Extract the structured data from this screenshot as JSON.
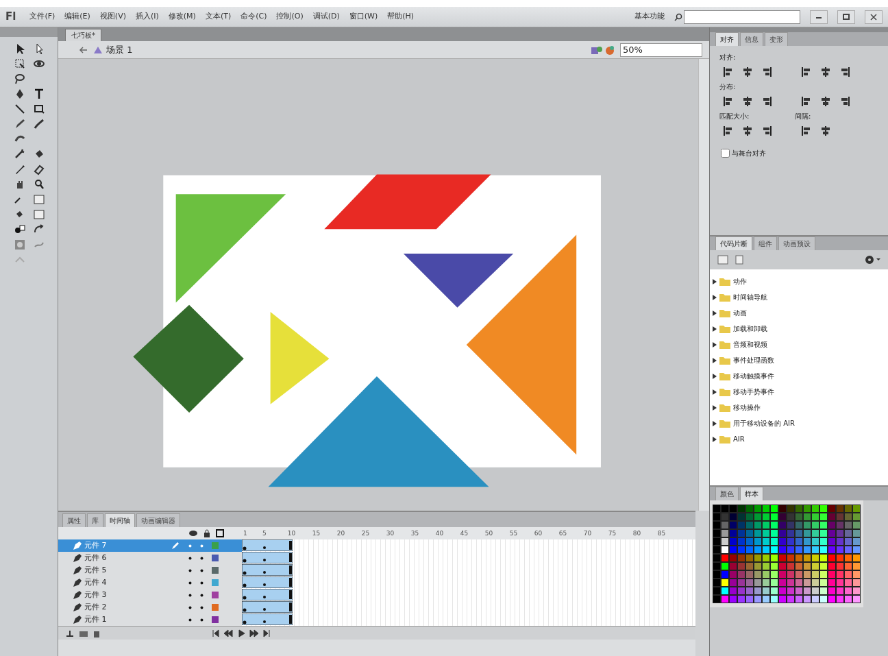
{
  "app": {
    "logo": "Fl",
    "workspace": "基本功能"
  },
  "menu": [
    "文件(F)",
    "编辑(E)",
    "视图(V)",
    "插入(I)",
    "修改(M)",
    "文本(T)",
    "命令(C)",
    "控制(O)",
    "调试(D)",
    "窗口(W)",
    "帮助(H)"
  ],
  "document_tabs": [
    {
      "label": "七巧板*",
      "selected": true
    }
  ],
  "scene": {
    "label": "场景 1",
    "zoom": "50%"
  },
  "align_panel": {
    "tabs": [
      {
        "label": "对齐",
        "selected": true
      },
      {
        "label": "信息",
        "selected": false
      },
      {
        "label": "变形",
        "selected": false
      }
    ],
    "sections": [
      {
        "label": "对齐:"
      },
      {
        "label": "分布:"
      },
      {
        "label": "匹配大小:"
      },
      {
        "label": "间隔:"
      }
    ],
    "stage_align": {
      "label": "与舞台对齐",
      "checked": false
    }
  },
  "snippets_panel": {
    "tabs": [
      {
        "label": "代码片断",
        "selected": true
      },
      {
        "label": "组件",
        "selected": false
      },
      {
        "label": "动画预设",
        "selected": false
      }
    ],
    "folders": [
      {
        "label": "动作"
      },
      {
        "label": "时间轴导航"
      },
      {
        "label": "动画"
      },
      {
        "label": "加载和卸载"
      },
      {
        "label": "音频和视频"
      },
      {
        "label": "事件处理函数"
      },
      {
        "label": "移动触摸事件"
      },
      {
        "label": "移动手势事件"
      },
      {
        "label": "移动操作"
      },
      {
        "label": "用于移动设备的 AIR"
      },
      {
        "label": "AIR"
      }
    ]
  },
  "swatches_panel": {
    "tabs": [
      {
        "label": "颜色",
        "selected": false
      },
      {
        "label": "样本",
        "selected": true
      }
    ]
  },
  "timeline": {
    "tabs": [
      {
        "label": "属性",
        "selected": false
      },
      {
        "label": "库",
        "selected": false
      },
      {
        "label": "时间轴",
        "selected": true
      },
      {
        "label": "动画编辑器",
        "selected": false
      }
    ],
    "ruler": [
      "1",
      "5",
      "10",
      "15",
      "20",
      "25",
      "30",
      "35",
      "40",
      "45",
      "50",
      "55",
      "60",
      "65",
      "70",
      "75",
      "80",
      "85"
    ],
    "layers": [
      {
        "name": "元件 7",
        "selected": true,
        "color": "#3aa04a"
      },
      {
        "name": "元件 6",
        "selected": false,
        "color": "#4a5ab0"
      },
      {
        "name": "元件 5",
        "selected": false,
        "color": "#5a6a6a"
      },
      {
        "name": "元件 4",
        "selected": false,
        "color": "#40a8d0"
      },
      {
        "name": "元件 3",
        "selected": false,
        "color": "#a040a0"
      },
      {
        "name": "元件 2",
        "selected": false,
        "color": "#e06a20"
      },
      {
        "name": "元件 1",
        "selected": false,
        "color": "#8030a0"
      }
    ]
  }
}
